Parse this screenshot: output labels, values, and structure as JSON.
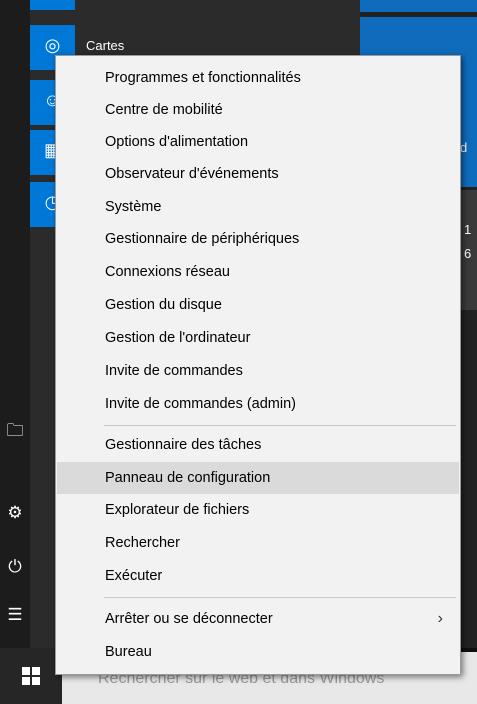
{
  "app_list": {
    "cartes_label": "Cartes"
  },
  "tiles": {
    "partial_text_1": "d",
    "partial_text_2": "1",
    "partial_text_3": "6"
  },
  "context_menu": {
    "items": [
      {
        "label": "Programmes et fonctionnalités"
      },
      {
        "label": "Centre de mobilité"
      },
      {
        "label": "Options d'alimentation"
      },
      {
        "label": "Observateur d'événements"
      },
      {
        "label": "Système"
      },
      {
        "label": "Gestionnaire de périphériques"
      },
      {
        "label": "Connexions réseau"
      },
      {
        "label": "Gestion du disque"
      },
      {
        "label": "Gestion de l'ordinateur"
      },
      {
        "label": "Invite de commandes"
      },
      {
        "label": "Invite de commandes (admin)"
      },
      {
        "label": "Gestionnaire des tâches"
      },
      {
        "label": "Panneau de configuration",
        "highlighted": true
      },
      {
        "label": "Explorateur de fichiers"
      },
      {
        "label": "Rechercher"
      },
      {
        "label": "Exécuter"
      },
      {
        "label": "Arrêter ou se déconnecter",
        "has_submenu": true
      },
      {
        "label": "Bureau"
      }
    ]
  },
  "taskbar": {
    "search_placeholder": "Rechercher sur le web et dans Windows"
  },
  "colors": {
    "accent": "#0078d7",
    "menu_bg": "#f2f2f2",
    "menu_highlight": "#dadada"
  }
}
